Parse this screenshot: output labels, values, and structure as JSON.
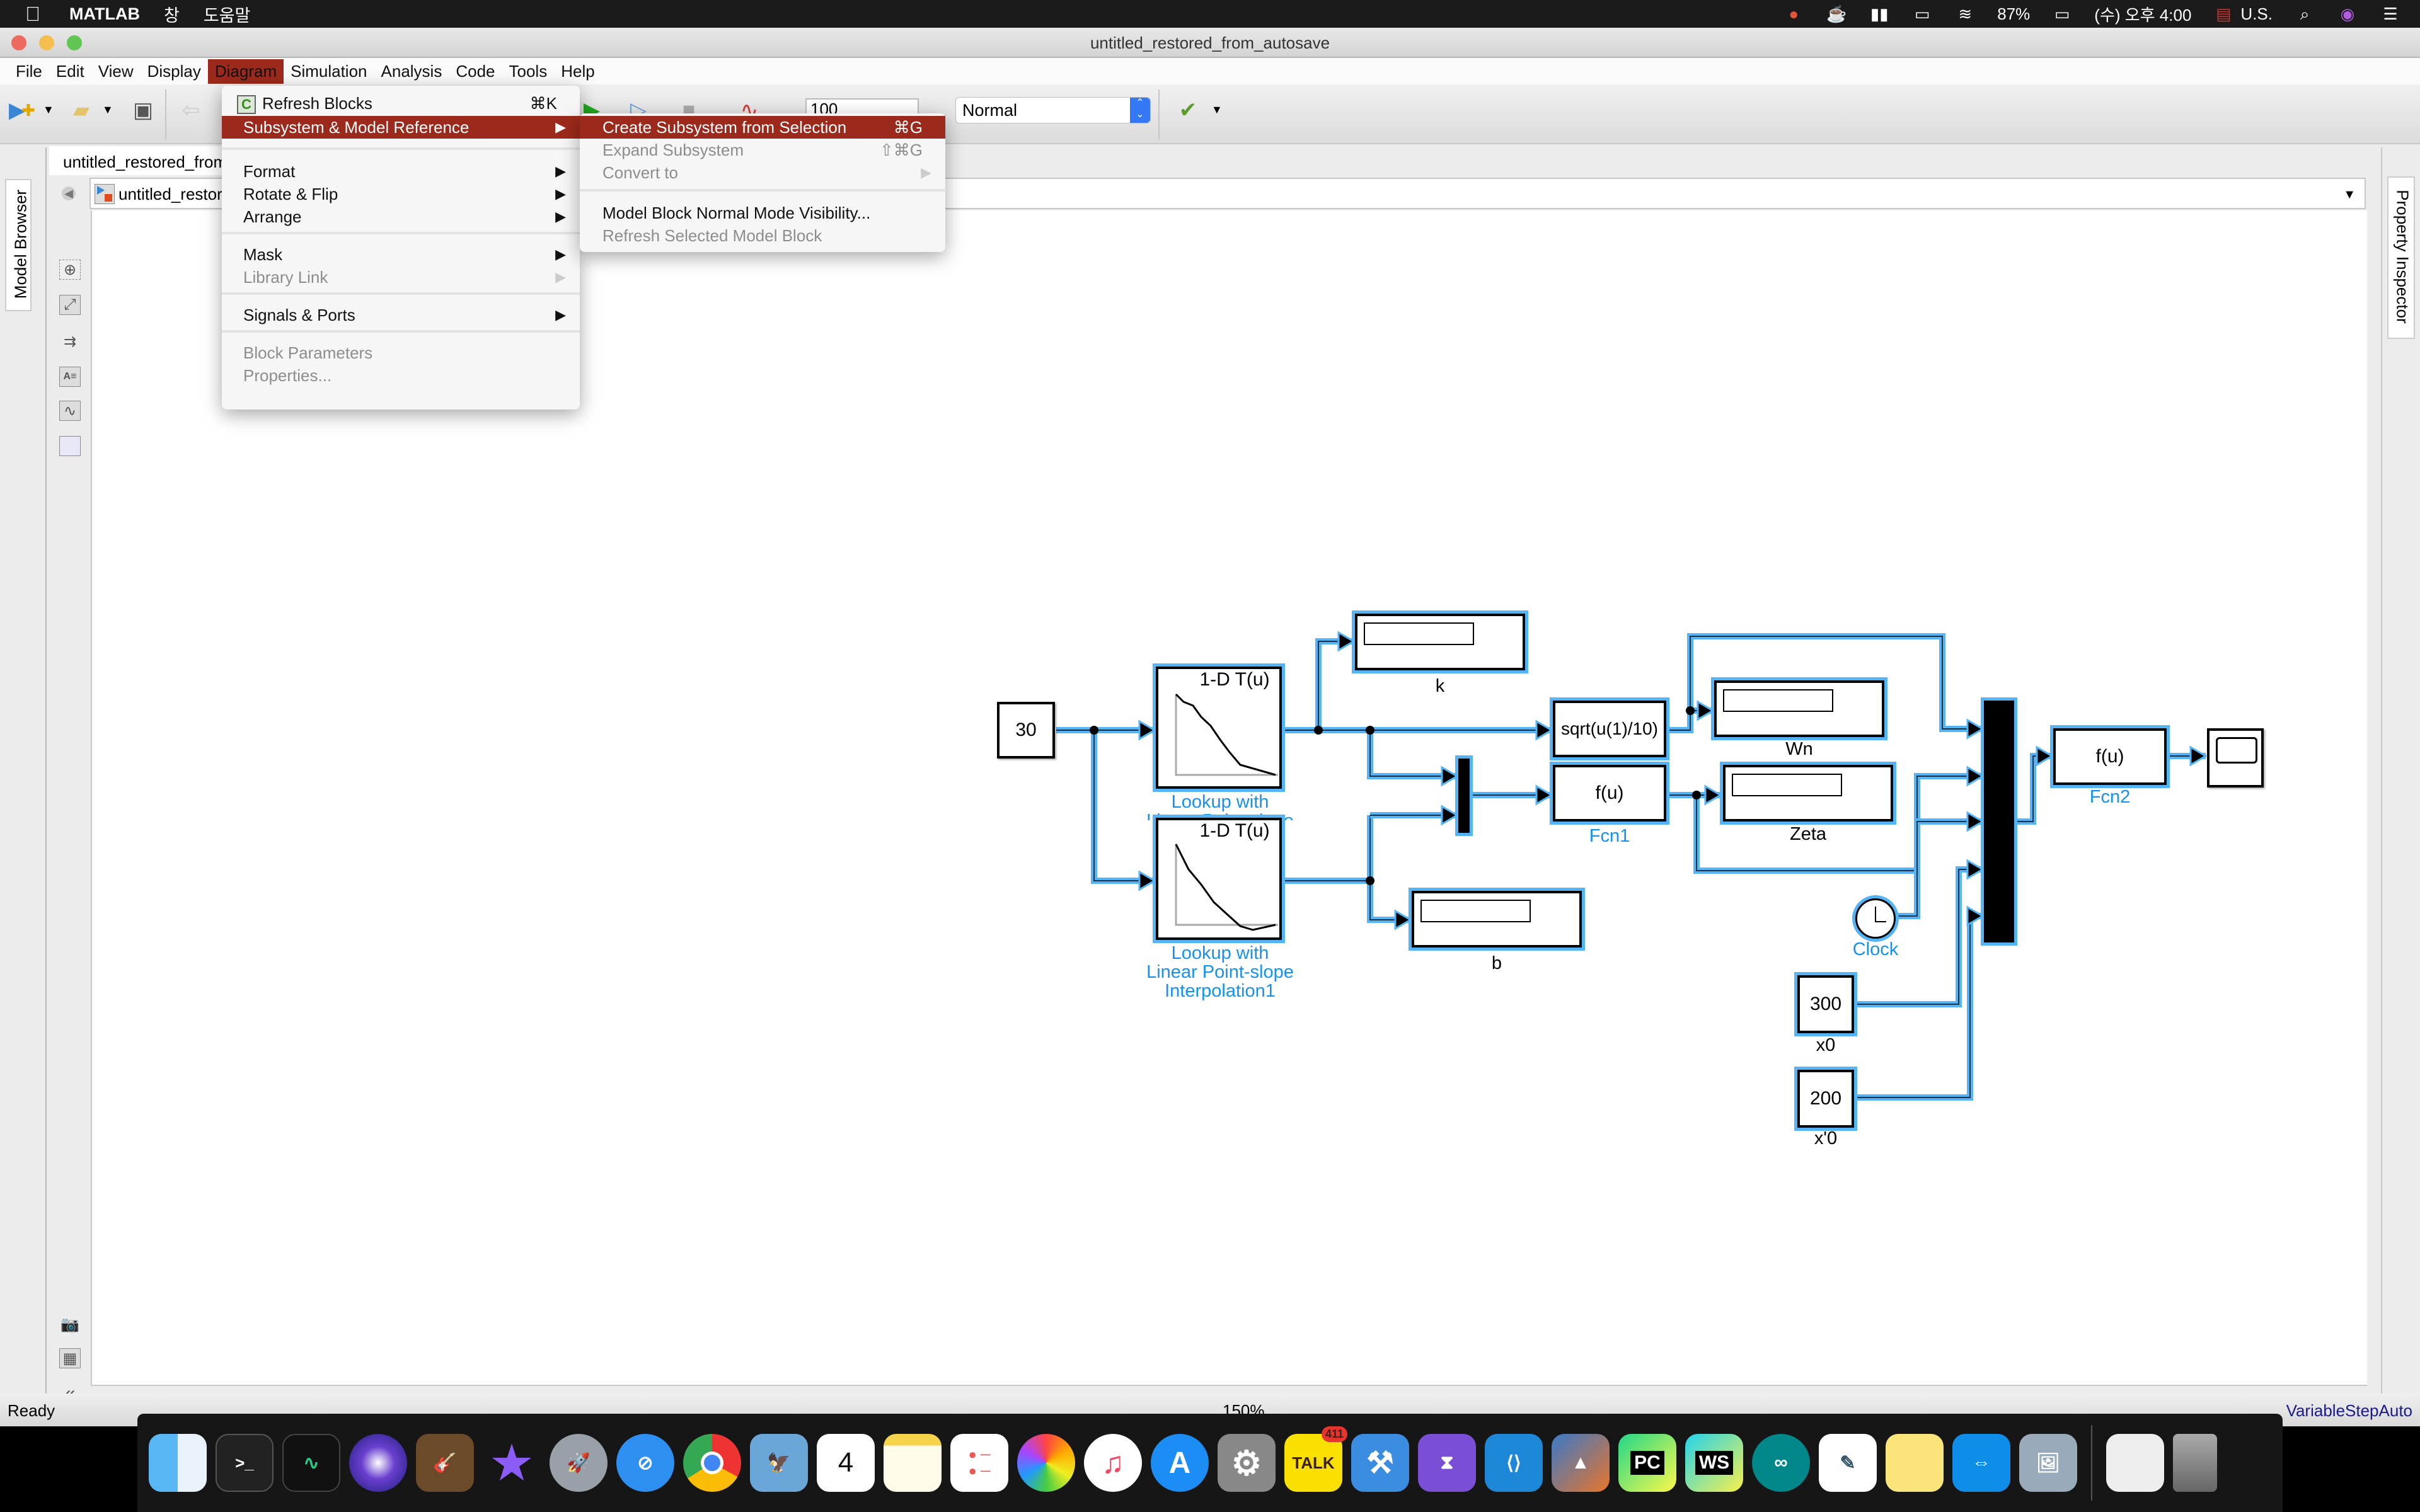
{
  "mac_menubar": {
    "app_name": "MATLAB",
    "items": [
      "창",
      "도움말"
    ],
    "battery": "87%",
    "clock": "(수) 오후 4:00",
    "input_source": "U.S."
  },
  "window": {
    "title": "untitled_restored_from_autosave"
  },
  "menubar": {
    "items": [
      "File",
      "Edit",
      "View",
      "Display",
      "Diagram",
      "Simulation",
      "Analysis",
      "Code",
      "Tools",
      "Help"
    ],
    "active": "Diagram"
  },
  "toolbar": {
    "stop_time": "100",
    "sim_mode": "Normal"
  },
  "model_browser_label": "Model Browser",
  "property_inspector_label": "Property Inspector",
  "model_tab": "untitled_restored_from_autosave",
  "breadcrumb": "untitled_restored_from_autosave",
  "diagram_menu": {
    "items": [
      {
        "label": "Refresh Blocks",
        "shortcut": "⌘K",
        "enabled": true,
        "submenu": false
      },
      {
        "label": "Subsystem & Model Reference",
        "shortcut": "",
        "enabled": true,
        "submenu": true,
        "highlighted": true
      },
      {
        "label": "Format",
        "enabled": true,
        "submenu": true
      },
      {
        "label": "Rotate & Flip",
        "enabled": true,
        "submenu": true
      },
      {
        "label": "Arrange",
        "enabled": true,
        "submenu": true
      },
      {
        "label": "Mask",
        "enabled": true,
        "submenu": true
      },
      {
        "label": "Library Link",
        "enabled": false,
        "submenu": true
      },
      {
        "label": "Signals & Ports",
        "enabled": true,
        "submenu": true
      },
      {
        "label": "Block Parameters",
        "enabled": false,
        "submenu": false
      },
      {
        "label": "Properties...",
        "enabled": false,
        "submenu": false
      }
    ]
  },
  "subsystem_menu": {
    "items": [
      {
        "label": "Create Subsystem from Selection",
        "shortcut": "⌘G",
        "enabled": true,
        "highlighted": true
      },
      {
        "label": "Expand Subsystem",
        "shortcut": "⇧⌘G",
        "enabled": false
      },
      {
        "label": "Convert to",
        "enabled": false,
        "submenu": true
      },
      {
        "label": "Model Block Normal Mode Visibility...",
        "enabled": true
      },
      {
        "label": "Refresh Selected Model Block",
        "enabled": false
      }
    ]
  },
  "diagram": {
    "const_30": "30",
    "lookup_title": "1-D T(u)",
    "lookup1_name": "Lookup with Linear Point-slope",
    "lookup2_name_lines": [
      "Lookup with",
      "Linear Point-slope",
      "Interpolation1"
    ],
    "display_k": "k",
    "display_b": "b",
    "fcn_sqrt": "sqrt(u(1)/10)",
    "fcn1_expr": "f(u)",
    "fcn1_name": "Fcn1",
    "display_wn": "Wn",
    "display_zeta": "Zeta",
    "clock_name": "Clock",
    "const_300": "300",
    "const_300_name": "x0",
    "const_200": "200",
    "const_200_name": "x'0",
    "fcn2_expr": "f(u)",
    "fcn2_name": "Fcn2"
  },
  "status": {
    "left": "Ready",
    "zoom": "150%",
    "solver": "VariableStepAuto"
  },
  "dock": {
    "apps": [
      "Finder",
      "Terminal",
      "Activity Monitor",
      "Siri",
      "GarageBand",
      "iMovie",
      "Launchpad",
      "Safari",
      "Chrome",
      "Mail",
      "Calendar",
      "Notes",
      "Reminders",
      "Photos",
      "Music",
      "App Store",
      "System Preferences",
      "KakaoTalk",
      "Xcode",
      "Visual Studio",
      "VS Code",
      "MATLAB",
      "PyCharm",
      "WebStorm",
      "Arduino",
      "TextEdit",
      "Stickies",
      "TeamViewer",
      "Preview",
      "Downloads",
      "Trash"
    ],
    "calendar_day": "4",
    "kakaotalk_badge": "411"
  }
}
